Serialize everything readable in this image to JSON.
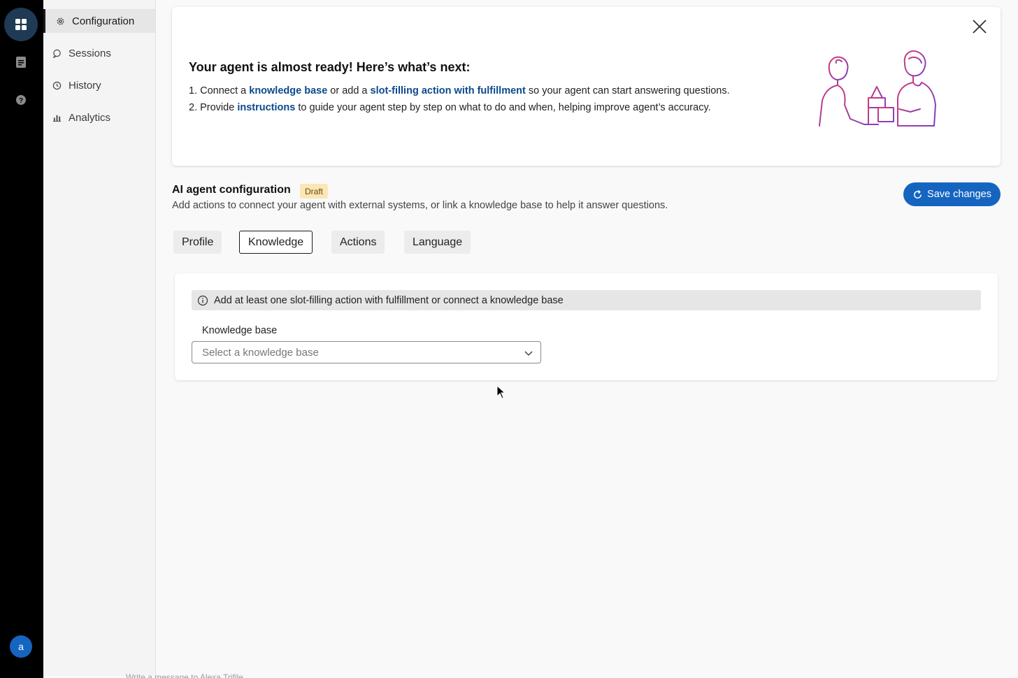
{
  "nav": {
    "items": [
      {
        "label": "Configuration",
        "icon": "gear-icon"
      },
      {
        "label": "Sessions",
        "icon": "chat-icon"
      },
      {
        "label": "History",
        "icon": "clock-icon"
      },
      {
        "label": "Analytics",
        "icon": "chart-icon"
      }
    ],
    "active": "Configuration"
  },
  "rail": {
    "icons": [
      "grid-icon",
      "document-icon",
      "help-icon"
    ],
    "avatar_letter": "a"
  },
  "banner": {
    "title": "Your agent is almost ready! Here’s what’s next:",
    "step1_a": "1. Connect a ",
    "step1_link1": "knowledge base",
    "step1_b": " or add a ",
    "step1_link2": "slot-filling action with fulfillment",
    "step1_c": " so your agent can start answering questions.",
    "step2_a": "2. Provide ",
    "step2_link": "instructions",
    "step2_b": " to guide your agent step by step on what to do and when, helping improve agent’s accuracy."
  },
  "config": {
    "title": "AI agent configuration",
    "status_badge": "Draft",
    "description": "Add actions to connect your agent with external systems, or link a knowledge base to help it answer questions.",
    "save_label": "Save changes"
  },
  "tabs": [
    {
      "label": "Profile"
    },
    {
      "label": "Knowledge"
    },
    {
      "label": "Actions"
    },
    {
      "label": "Language"
    }
  ],
  "active_tab": "Knowledge",
  "knowledge": {
    "notice": "Add at least one slot-filling action with fulfillment or connect a knowledge base",
    "field_label": "Knowledge base",
    "select_placeholder": "Select a knowledge base"
  },
  "footer_hint": "Write a message to Alexa Trifile",
  "colors": {
    "accent": "#1565c0",
    "link": "#0b4a8c",
    "draft_bg": "#fbe6b8",
    "rail_bg": "#000000",
    "illustration_start": "#c23b7a",
    "illustration_end": "#7b3fc4"
  }
}
